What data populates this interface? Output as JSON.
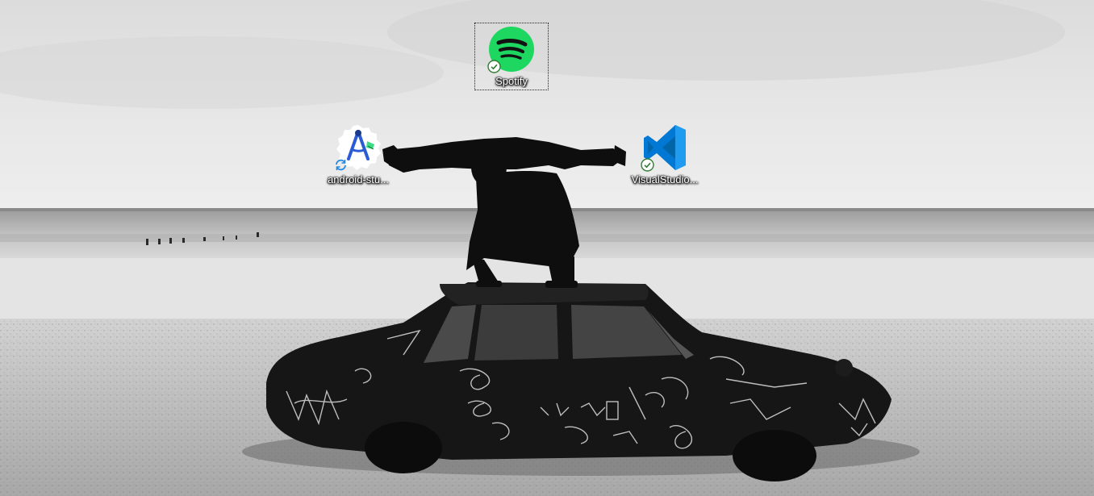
{
  "desktop": {
    "icons": [
      {
        "label": "Spotify",
        "status": "synced",
        "selected": true
      },
      {
        "label": "android-stu...",
        "status": "syncing",
        "selected": false
      },
      {
        "label": "VisualStudio...",
        "status": "synced",
        "selected": false
      }
    ]
  },
  "colors": {
    "spotify_green": "#1ed760",
    "vscode_blue": "#0065a9",
    "synced_check": "#2e7d32",
    "syncing_blue": "#1e88e5"
  }
}
